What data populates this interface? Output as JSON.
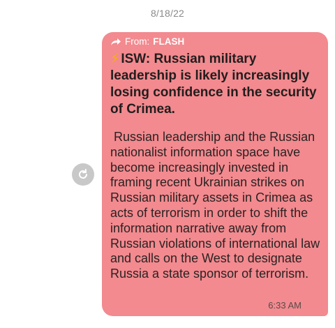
{
  "thread": {
    "date": "8/18/22"
  },
  "message": {
    "forward_label": "From:",
    "forward_source": "FLASH",
    "headline_icon": "⚡",
    "headline": "ISW: Russian military leadership is likely increasingly losing confidence in the security of Crimea.",
    "body": " Russian leadership and the Russian nationalist information space have become increasingly invested in framing recent Ukrainian strikes on Russian military assets in Crimea as acts of terrorism in order to shift the information narrative away from Russian violations of international law and calls on the West to designate Russia a state sponsor of terrorism.",
    "time": "6:33 AM",
    "bubble_color": "#f28a8f"
  },
  "icons": {
    "forward": "forward-arrow-icon",
    "resend": "refresh-icon",
    "bolt": "lightning-icon"
  }
}
